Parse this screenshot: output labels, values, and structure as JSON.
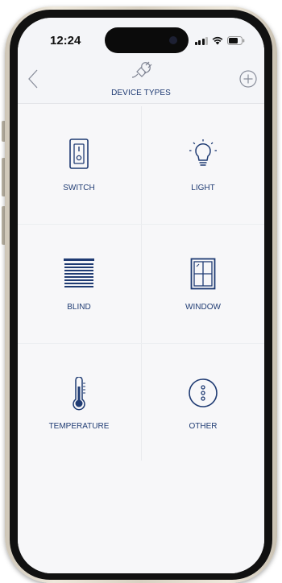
{
  "status": {
    "time": "12:24"
  },
  "header": {
    "title": "DEVICE TYPES",
    "icon": "plug-icon",
    "back_icon": "chevron-left-icon",
    "add_icon": "plus-circle-icon"
  },
  "device_types": [
    {
      "label": "SWITCH",
      "icon": "switch-icon"
    },
    {
      "label": "LIGHT",
      "icon": "lightbulb-icon"
    },
    {
      "label": "BLIND",
      "icon": "blind-icon"
    },
    {
      "label": "WINDOW",
      "icon": "window-icon"
    },
    {
      "label": "TEMPERATURE",
      "icon": "thermometer-icon"
    },
    {
      "label": "OTHER",
      "icon": "more-icon"
    }
  ],
  "colors": {
    "accent": "#1f3b73",
    "background": "#f7f7f9"
  }
}
